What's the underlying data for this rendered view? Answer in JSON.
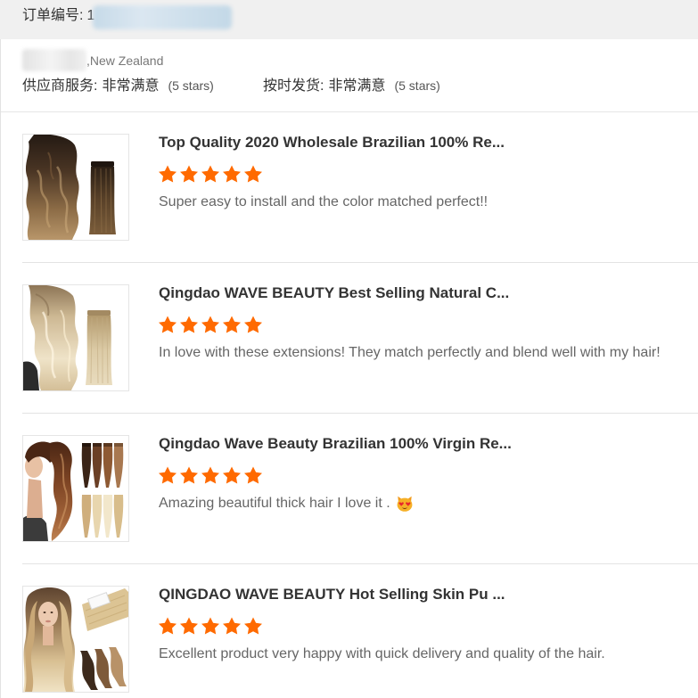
{
  "header": {
    "order_label": "订单编号:",
    "order_number_visible": "1"
  },
  "buyer": {
    "location": ",New Zealand"
  },
  "ratings": [
    {
      "label": "供应商服务:",
      "value": "非常满意",
      "stars_text": "(5 stars)"
    },
    {
      "label": "按时发货:",
      "value": "非常满意",
      "stars_text": "(5 stars)"
    }
  ],
  "reviews": [
    {
      "title": "Top Quality 2020 Wholesale Brazilian 100% Re...",
      "rating": 5,
      "comment": "Super easy to install and the color matched perfect!!"
    },
    {
      "title": "Qingdao WAVE BEAUTY Best Selling Natural C...",
      "rating": 5,
      "comment": "In love with these extensions! They match perfectly and blend well with my hair!"
    },
    {
      "title": "Qingdao Wave Beauty Brazilian 100% Virgin Re...",
      "rating": 5,
      "comment": "Amazing beautiful thick hair I love it .",
      "emoji_icon": "heart-eyes-cat-emoji-icon"
    },
    {
      "title": "QINGDAO WAVE BEAUTY Hot Selling Skin Pu ...",
      "rating": 5,
      "comment": "Excellent product very happy with quick delivery and quality of the hair."
    }
  ],
  "colors": {
    "star": "#ff6a00",
    "header_bg": "#f0f0f0",
    "title_text": "#333333",
    "comment_text": "#666666",
    "divider": "#e3e3e3"
  }
}
